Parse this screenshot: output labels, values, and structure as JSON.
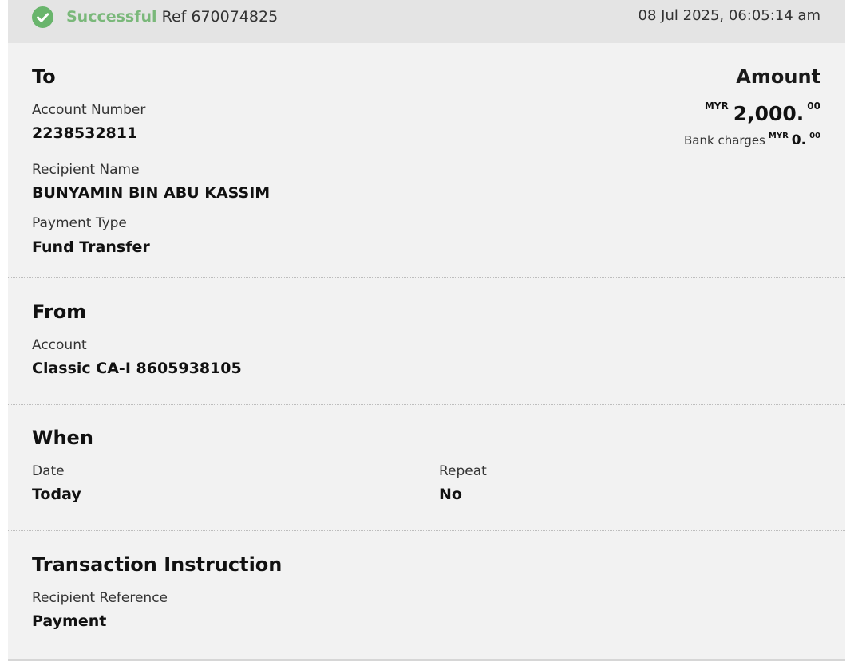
{
  "header": {
    "status": "Successful",
    "ref": "Ref 670074825",
    "datetime": "08 Jul 2025, 06:05:14 am"
  },
  "to": {
    "title": "To",
    "account_number_label": "Account Number",
    "account_number": "2238532811",
    "recipient_name_label": "Recipient Name",
    "recipient_name": "BUNYAMIN BIN ABU KASSIM",
    "payment_type_label": "Payment Type",
    "payment_type": "Fund Transfer"
  },
  "amount": {
    "title": "Amount",
    "currency": "MYR",
    "whole": "2,000.",
    "cents": "00",
    "bank_charges_label": "Bank charges",
    "bank_charges_currency": "MYR",
    "bank_charges_whole": "0.",
    "bank_charges_cents": "00"
  },
  "from": {
    "title": "From",
    "account_label": "Account",
    "account": "Classic CA-I 8605938105"
  },
  "when": {
    "title": "When",
    "date_label": "Date",
    "date": "Today",
    "repeat_label": "Repeat",
    "repeat": "No"
  },
  "instruction": {
    "title": "Transaction Instruction",
    "recipient_reference_label": "Recipient Reference",
    "recipient_reference": "Payment"
  },
  "icons": {
    "status": "check-circle-icon"
  },
  "colors": {
    "success": "#7ab87a",
    "check_circle": "#69b56c"
  }
}
